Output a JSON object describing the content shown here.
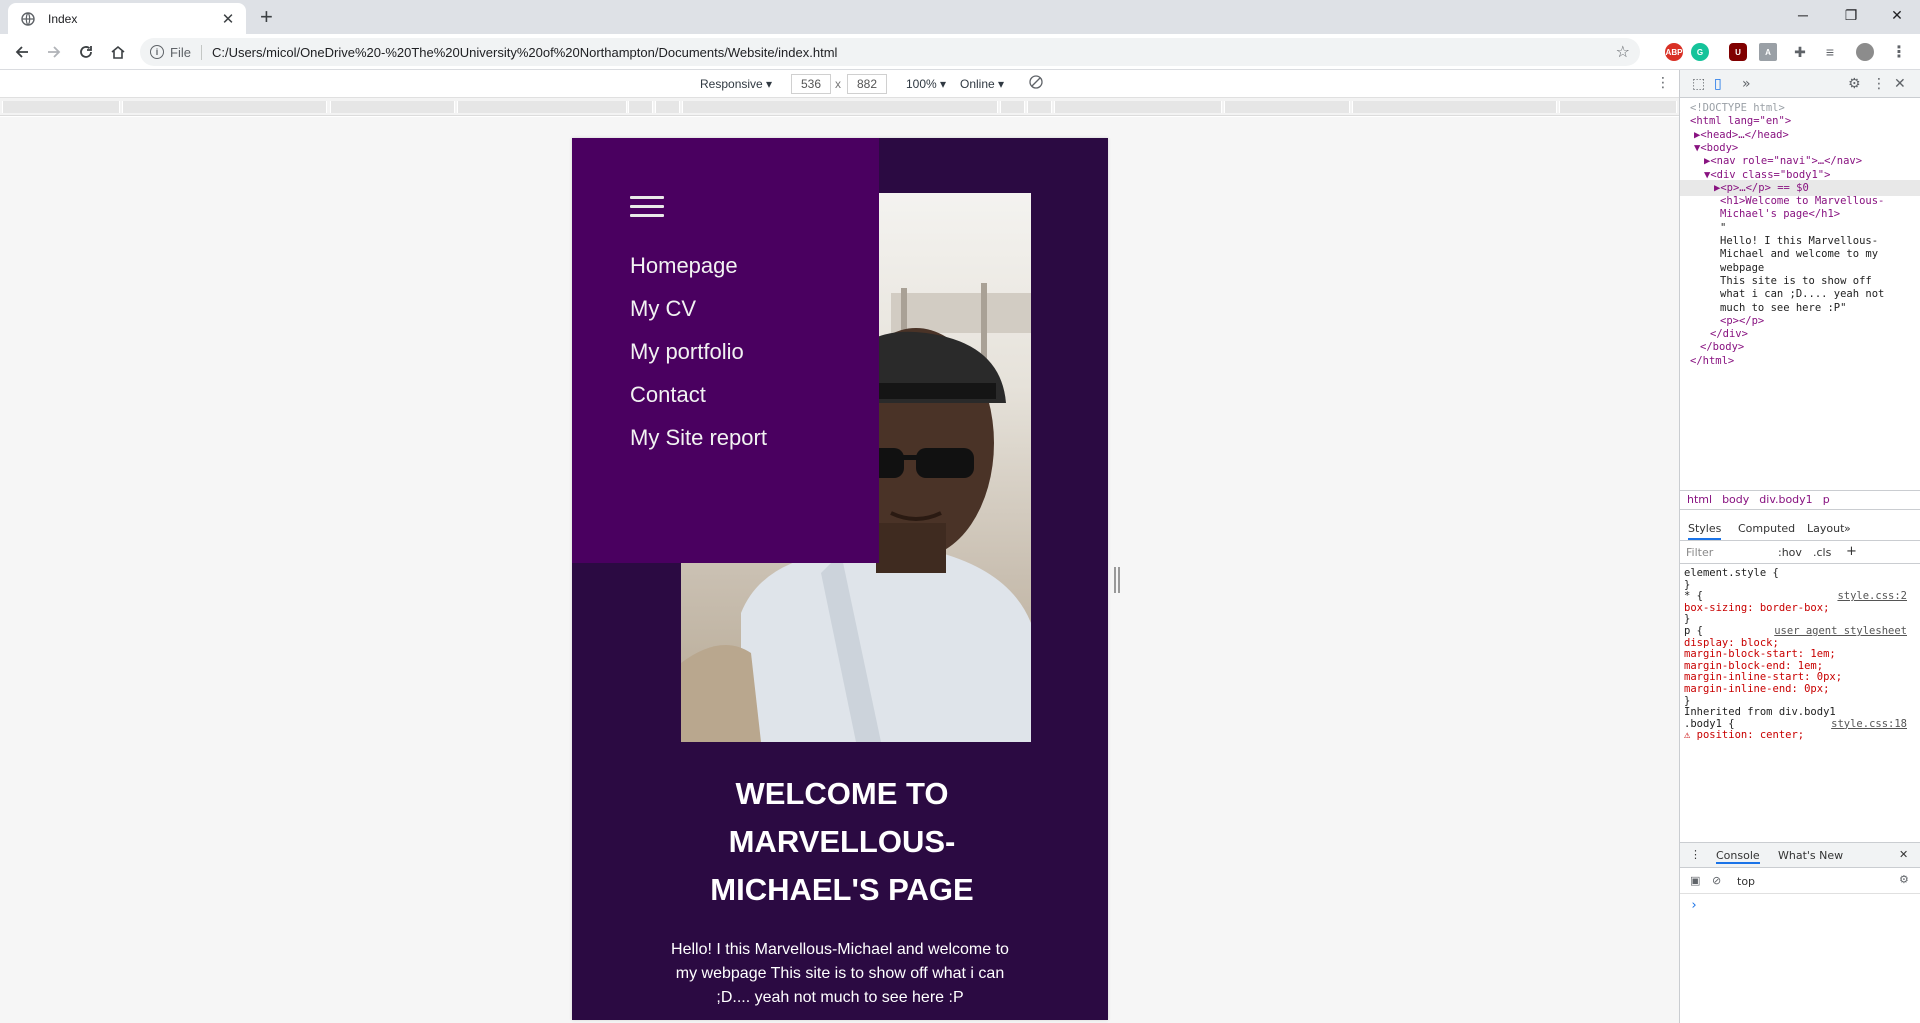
{
  "browser": {
    "tab_title": "Index",
    "new_tab": "+",
    "window_controls": [
      "─",
      "❐",
      "✕"
    ],
    "address_scheme": "File",
    "address_url": "C:/Users/micol/OneDrive%20-%20The%20University%20of%20Northampton/Documents/Website/index.html"
  },
  "device_toolbar": {
    "mode": "Responsive",
    "width": "536",
    "x": "x",
    "height": "882",
    "zoom": "100%",
    "network": "Online"
  },
  "site": {
    "nav_links": [
      "Homepage",
      "My CV",
      "My portfolio",
      "Contact",
      "My Site report"
    ],
    "heading": "Welcome to Marvellous-Michael's page",
    "intro": "Hello! I this Marvellous-Michael and welcome to my webpage This site is to show off what i can ;D.... yeah not much to see here :P"
  },
  "devtools": {
    "dom": [
      {
        "t": "<!DOCTYPE html>",
        "cls": "cmt",
        "indent": 10
      },
      {
        "t": "<html lang=\"en\">",
        "cls": "",
        "indent": 10
      },
      {
        "t": "▶<head>…</head>",
        "cls": "",
        "indent": 14
      },
      {
        "t": "▼<body>",
        "cls": "",
        "indent": 14
      },
      {
        "t": "▶<nav role=\"navi\">…</nav>",
        "cls": "",
        "indent": 24
      },
      {
        "t": "▼<div class=\"body1\">",
        "cls": "",
        "indent": 24
      },
      {
        "t": "▶<p>…</p> == $0",
        "cls": "sel",
        "indent": 34
      },
      {
        "t": "<h1>Welcome to Marvellous-",
        "cls": "",
        "indent": 40
      },
      {
        "t": "Michael's page</h1>",
        "cls": "",
        "indent": 40
      },
      {
        "t": "\"",
        "cls": "txt",
        "indent": 40
      },
      {
        "t": "  Hello! I this Marvellous-",
        "cls": "txt",
        "indent": 40
      },
      {
        "t": "Michael and welcome to my",
        "cls": "txt",
        "indent": 40
      },
      {
        "t": "webpage",
        "cls": "txt",
        "indent": 40
      },
      {
        "t": "  This site is to show off",
        "cls": "txt",
        "indent": 40
      },
      {
        "t": "what i can ;D.... yeah not",
        "cls": "txt",
        "indent": 40
      },
      {
        "t": "much to see here :P\"",
        "cls": "txt",
        "indent": 40
      },
      {
        "t": "<p></p>",
        "cls": "",
        "indent": 40
      },
      {
        "t": "</div>",
        "cls": "",
        "indent": 30
      },
      {
        "t": "</body>",
        "cls": "",
        "indent": 20
      },
      {
        "t": "</html>",
        "cls": "",
        "indent": 10
      }
    ],
    "breadcrumbs": [
      "html",
      "body",
      "div.body1",
      "p"
    ],
    "subtabs": [
      "Styles",
      "Computed",
      "Layout",
      "»"
    ],
    "filter_placeholder": "Filter",
    "hov": ":hov",
    "cls": ".cls",
    "styles": [
      {
        "t": "element.style {",
        "src": ""
      },
      {
        "t": "}",
        "src": ""
      },
      {
        "t": "* {",
        "src": "style.css:2"
      },
      {
        "t": "  box-sizing: border-box;",
        "src": "",
        "prop": true
      },
      {
        "t": "}",
        "src": ""
      },
      {
        "t": "p {",
        "src": "user agent stylesheet"
      },
      {
        "t": "  display: block;",
        "src": "",
        "prop": true
      },
      {
        "t": "  margin-block-start: 1em;",
        "src": "",
        "prop": true
      },
      {
        "t": "  margin-block-end: 1em;",
        "src": "",
        "prop": true
      },
      {
        "t": "  margin-inline-start: 0px;",
        "src": "",
        "prop": true
      },
      {
        "t": "  margin-inline-end: 0px;",
        "src": "",
        "prop": true
      },
      {
        "t": "}",
        "src": ""
      },
      {
        "t": "Inherited from div.body1",
        "src": ""
      },
      {
        "t": ".body1 {",
        "src": "style.css:18"
      },
      {
        "t": "⚠ position: center;",
        "src": "",
        "prop": true
      }
    ],
    "console_tabs": [
      "Console",
      "What's New"
    ],
    "console_context": "top",
    "console_prompt": "›"
  }
}
